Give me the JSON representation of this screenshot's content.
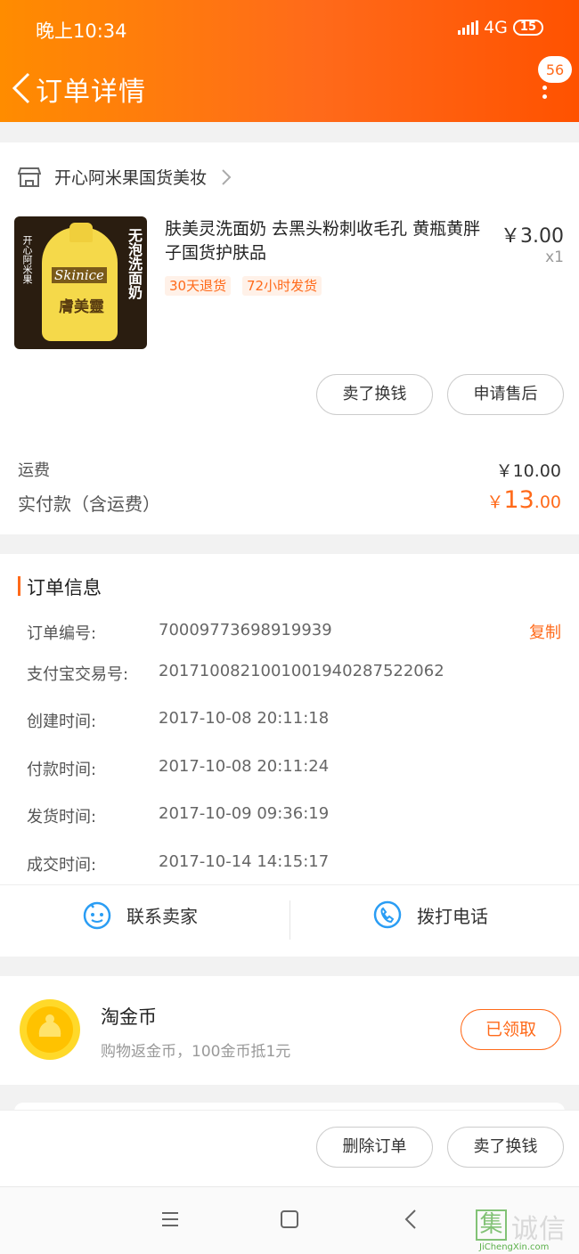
{
  "status_bar": {
    "time": "晚上10:34",
    "network": "4G",
    "battery": "15"
  },
  "header": {
    "title": "订单详情",
    "badge": "56"
  },
  "shop": {
    "name": "开心阿米果国货美妆"
  },
  "product": {
    "title": "肤美灵洗面奶 去黑头粉刺收毛孔 黄瓶黄胖子国货护肤品",
    "price": "￥3.00",
    "qty": "x1",
    "tags": [
      "30天退货",
      "72小时发货"
    ],
    "image_text": {
      "vertical": "无泡洗面奶",
      "brand": "Skinice",
      "cn_brand": "膚美靈",
      "side": "开心阿米果"
    }
  },
  "product_actions": {
    "sell": "卖了换钱",
    "after_sale": "申请售后"
  },
  "totals": {
    "shipping_label": "运费",
    "shipping": "￥10.00",
    "paid_label": "实付款（含运费）",
    "paid_symbol": "￥",
    "paid_int": "13",
    "paid_dec": ".00"
  },
  "order_info": {
    "section_title": "订单信息",
    "copy": "复制",
    "rows": [
      {
        "label": "订单编号:",
        "value": "70009773698919939"
      },
      {
        "label": "支付宝交易号:",
        "value": "2017100821001001940287522062"
      },
      {
        "label": "创建时间:",
        "value": "2017-10-08 20:11:18"
      },
      {
        "label": "付款时间:",
        "value": "2017-10-08 20:11:24"
      },
      {
        "label": "发货时间:",
        "value": "2017-10-09 09:36:19"
      },
      {
        "label": "成交时间:",
        "value": "2017-10-14 14:15:17"
      }
    ]
  },
  "contact": {
    "seller": "联系卖家",
    "call": "拨打电话"
  },
  "coins": {
    "title": "淘金币",
    "subtitle": "购物返金币，100金币抵1元",
    "button": "已领取"
  },
  "bottom_actions": {
    "delete": "删除订单",
    "sell": "卖了换钱"
  },
  "watermark": {
    "cn": "集诚信",
    "en": "JiChengXin.com"
  },
  "colors": {
    "accent": "#ff6a1a",
    "header_start": "#ff8c00"
  }
}
